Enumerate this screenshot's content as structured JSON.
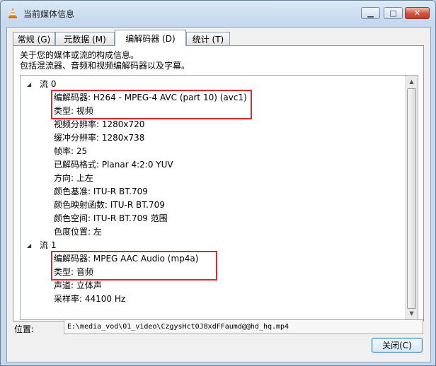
{
  "window": {
    "title": "当前媒体信息",
    "minimize_glyph": "▁",
    "maximize_glyph": "□",
    "close_glyph": "✕"
  },
  "tabs": [
    {
      "label": "常规 (G)",
      "active": false
    },
    {
      "label": "元数据 (M)",
      "active": false
    },
    {
      "label": "编解码器 (D)",
      "active": true
    },
    {
      "label": "统计 (T)",
      "active": false
    }
  ],
  "description": {
    "line1": "关于您的媒体或流的构成信息。",
    "line2": "包括混流器、音频和视频编解码器以及字幕。"
  },
  "streams": [
    {
      "label": "流 0",
      "properties": [
        "编解码器: H264 - MPEG-4 AVC (part 10) (avc1)",
        "类型: 视频",
        "视频分辨率: 1280x720",
        "缓冲分辨率: 1280x738",
        "帧率: 25",
        "已解码格式: Planar 4:2:0 YUV",
        "方向: 上左",
        "颜色基准: ITU-R BT.709",
        "颜色映射函数: ITU-R BT.709",
        "颜色空间: ITU-R BT.709 范围",
        "色度位置: 左"
      ]
    },
    {
      "label": "流 1",
      "properties": [
        "编解码器: MPEG AAC Audio (mp4a)",
        "类型: 音频",
        "声道: 立体声",
        "采样率: 44100 Hz"
      ]
    }
  ],
  "location": {
    "label": "位置:",
    "value": "E:\\media_vod\\01_video\\CzgysHct0J8xdFFaumd@@hd_hq.mp4"
  },
  "buttons": {
    "close": "关闭(C)"
  },
  "colors": {
    "highlight_box": "#e02626",
    "title_gradient": "#c6d9ef"
  }
}
